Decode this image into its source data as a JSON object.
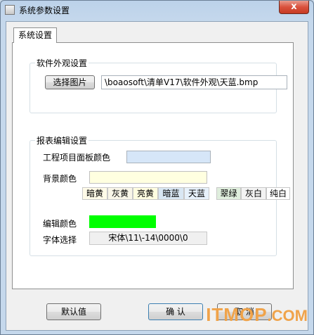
{
  "window": {
    "title": "系统参数设置",
    "close_glyph": "x"
  },
  "tab": {
    "label": "系统设置"
  },
  "appearance": {
    "group_title": "软件外观设置",
    "choose_image_label": "选择图片",
    "image_path": "\\boaosoft\\清单V17\\软件外观\\天蓝.bmp"
  },
  "report": {
    "group_title": "报表编辑设置",
    "panel_color_label": "工程项目面板颜色",
    "panel_color": "#d6e6f8",
    "background_label": "背景颜色",
    "background_color": "#ffffe0",
    "color_options": [
      {
        "label": "暗黄",
        "color": "#fffbe8"
      },
      {
        "label": "灰黄",
        "color": "#f9f6e8"
      },
      {
        "label": "亮黄",
        "color": "#fffde0"
      },
      {
        "label": "暗蓝",
        "color": "#d9e7f3"
      },
      {
        "label": "天蓝",
        "color": "#e7f1fb"
      },
      {
        "label": "翠绿",
        "color": "#dfeedd"
      },
      {
        "label": "灰白",
        "color": "#f3f3f3"
      },
      {
        "label": "纯白",
        "color": "#ffffff"
      }
    ],
    "edit_color_label": "编辑颜色",
    "edit_color": "#00ff00",
    "font_label": "字体选择",
    "font_value": "宋体\\11\\-14\\0000\\0"
  },
  "footer": {
    "default_label": "默认值",
    "ok_label": "确 认",
    "cancel_label": "取 消"
  },
  "watermark": {
    "brand_main": "ITMOP",
    "brand_suffix": ".COM",
    "color": "#f0a34a"
  }
}
